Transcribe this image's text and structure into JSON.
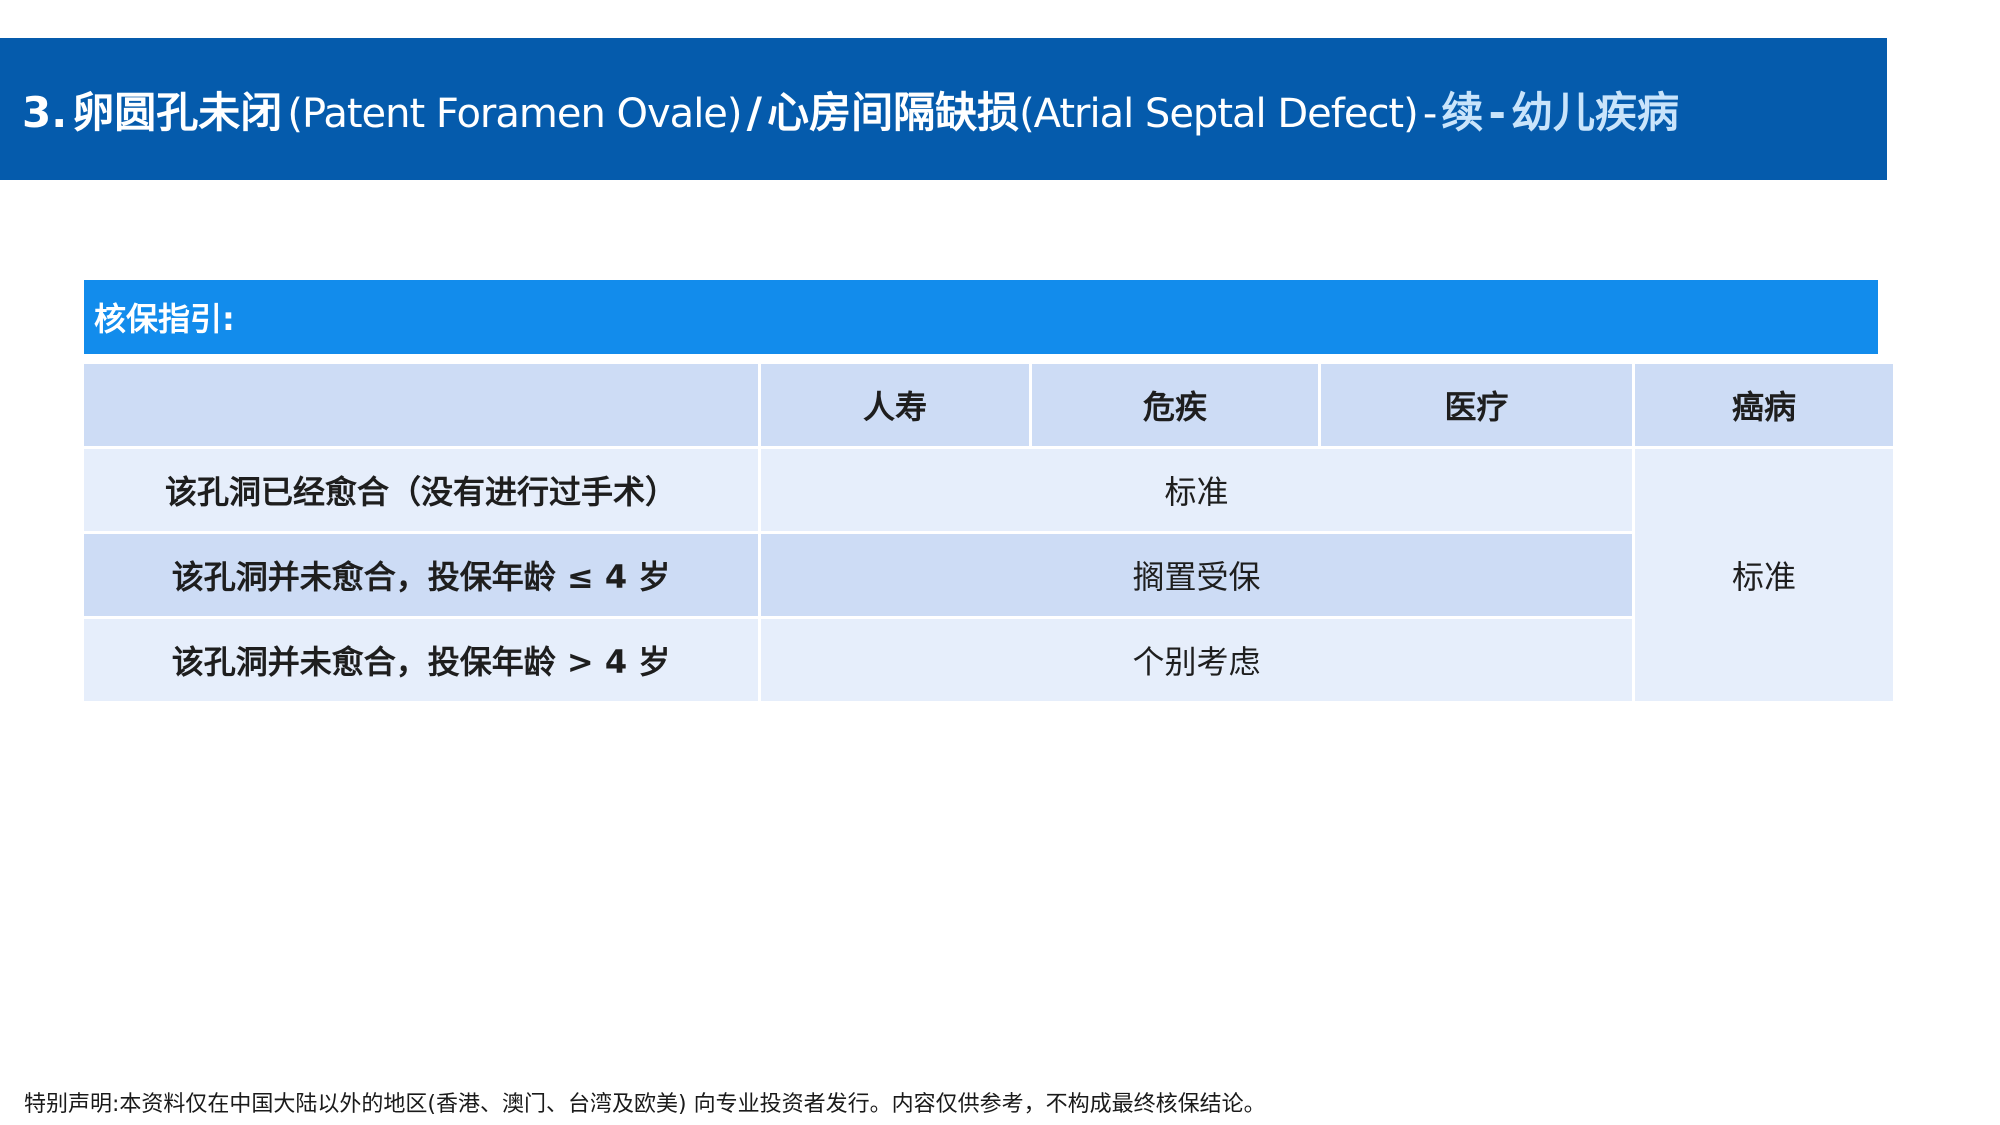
{
  "title": {
    "number": "3.",
    "zh1": "卵圆孔未闭",
    "en1": "(Patent Foramen Ovale)",
    "sep": "/",
    "zh2": "心房间隔缺损",
    "en2": "(Atrial Septal Defect)",
    "dash1": "-",
    "cont": "续",
    "dash2": "-",
    "category": "幼儿疾病"
  },
  "guide": {
    "heading": "核保指引:",
    "columns": [
      "",
      "人寿",
      "危疾",
      "医疗",
      "癌病"
    ],
    "rows": [
      {
        "label": "该孔洞已经愈合（没有进行过手术）",
        "value": "标准"
      },
      {
        "label": "该孔洞并未愈合，投保年龄 ≤ 4 岁",
        "value": "搁置受保"
      },
      {
        "label": "该孔洞并未愈合，投保年龄 > 4 岁",
        "value": "个别考虑"
      }
    ],
    "cancer_value": "标准"
  },
  "disclaimer": "特别声明:本资料仅在中国大陆以外的地区(香港、澳门、台湾及欧美) 向专业投资者发行。内容仅供参考，不构成最终核保结论。",
  "colors": {
    "title_bar": "#055bac",
    "title_accent": "#c9e4fb",
    "guide_header": "#128cec",
    "cell_mid": "#cddcf5",
    "cell_light": "#e6eefb"
  }
}
